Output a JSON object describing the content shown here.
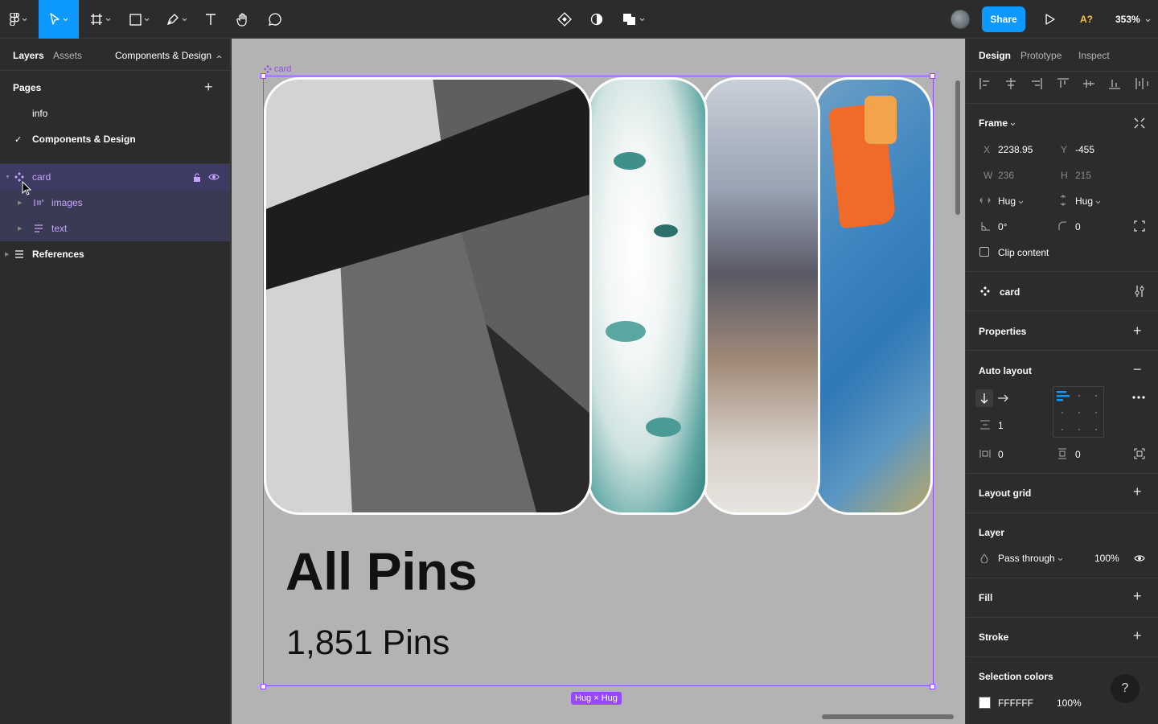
{
  "toolbar": {
    "share_label": "Share",
    "accessibility_label": "A?",
    "zoom_label": "353%"
  },
  "left_panel": {
    "tabs": {
      "layers": "Layers",
      "assets": "Assets",
      "page_selector": "Components & Design"
    },
    "pages_title": "Pages",
    "add_page_icon": "+",
    "pages": [
      {
        "label": "info"
      },
      {
        "label": "Components & Design",
        "checked": true
      }
    ],
    "layers": [
      {
        "label": "card"
      },
      {
        "label": "images"
      },
      {
        "label": "text"
      },
      {
        "label": "References"
      }
    ]
  },
  "canvas": {
    "frame_label": "card",
    "hug_badge": "Hug × Hug",
    "card_title": "All Pins",
    "card_subtitle": "1,851 Pins"
  },
  "right_panel": {
    "tabs": {
      "design": "Design",
      "prototype": "Prototype",
      "inspect": "Inspect"
    },
    "frame": {
      "title": "Frame",
      "x_label": "X",
      "x_value": "2238.95",
      "y_label": "Y",
      "y_value": "-455",
      "w_label": "W",
      "w_value": "236",
      "h_label": "H",
      "h_value": "215",
      "h_resize": "Hug",
      "v_resize": "Hug",
      "rotation": "0°",
      "radius": "0",
      "clip_content": "Clip content"
    },
    "component_name": "card",
    "properties_title": "Properties",
    "auto_layout": {
      "title": "Auto layout",
      "spacing": "1",
      "padding_h": "0",
      "padding_v": "0"
    },
    "layout_grid_title": "Layout grid",
    "layer": {
      "title": "Layer",
      "blend": "Pass through",
      "opacity": "100%"
    },
    "fill_title": "Fill",
    "stroke_title": "Stroke",
    "selection_colors": {
      "title": "Selection colors",
      "hex": "FFFFFF",
      "opacity": "100%"
    },
    "help_label": "?"
  },
  "colors": {
    "accent": "#0d99ff",
    "component": "#9747ff"
  }
}
